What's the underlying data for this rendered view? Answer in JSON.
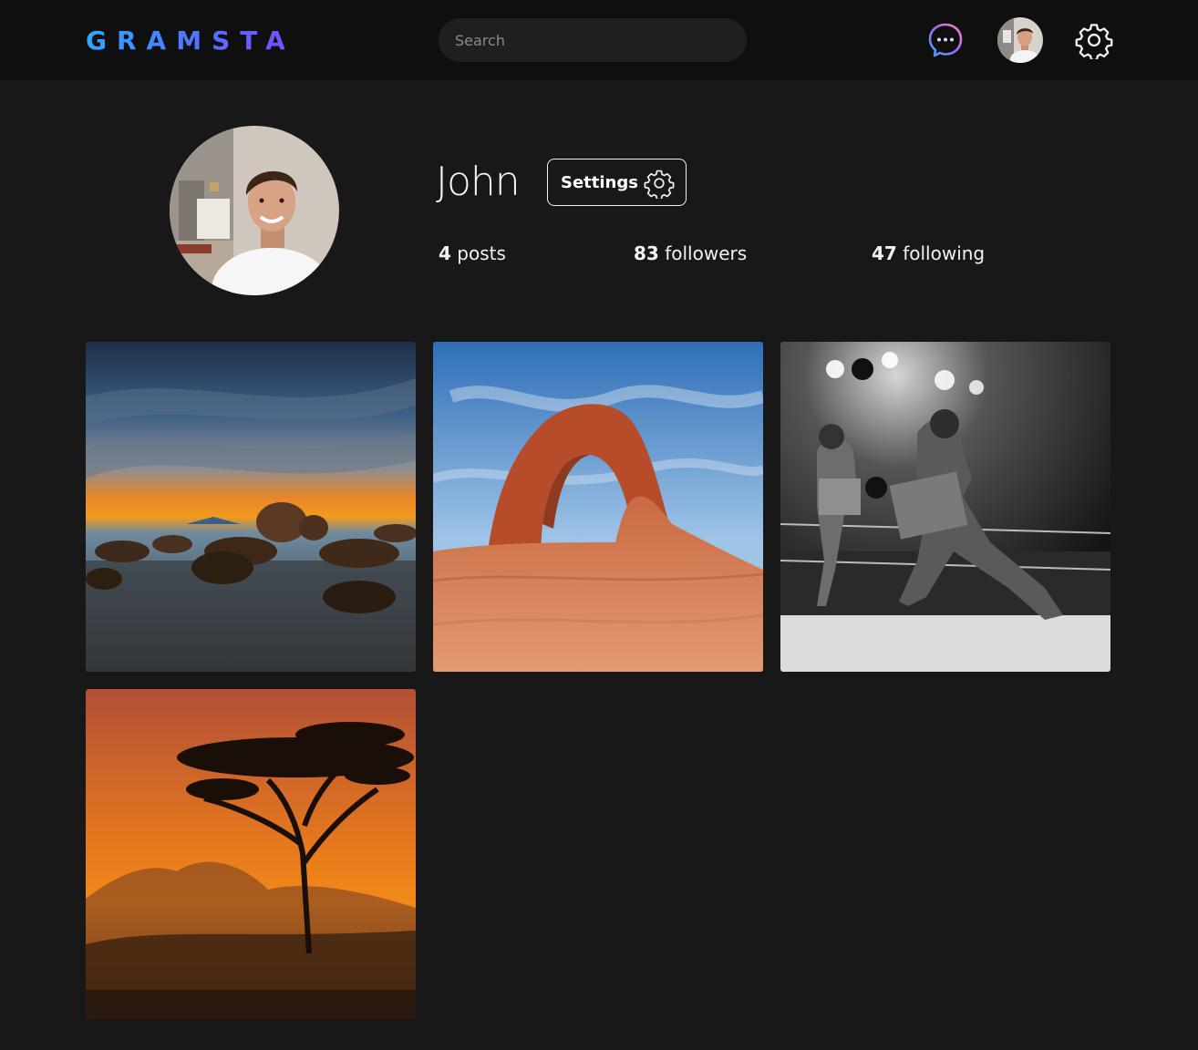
{
  "app": {
    "logo": "GRAMSTA"
  },
  "header": {
    "search_placeholder": "Search",
    "icons": [
      "messenger-icon",
      "avatar",
      "gear-icon"
    ]
  },
  "profile": {
    "username": "John",
    "settings_label": "Settings",
    "stats": [
      {
        "count": "4",
        "label": "posts"
      },
      {
        "count": "83",
        "label": "followers"
      },
      {
        "count": "47",
        "label": "following"
      }
    ]
  },
  "posts": [
    {
      "subject": "sunset-rocks-photo"
    },
    {
      "subject": "desert-arch-photo"
    },
    {
      "subject": "boxing-match-photo"
    },
    {
      "subject": "acacia-sunset-photo"
    }
  ],
  "colors": {
    "background": "#181818",
    "topbar": "#0f0f0f",
    "logo_gradient": [
      "#2ea8ff",
      "#7a4bff"
    ]
  }
}
